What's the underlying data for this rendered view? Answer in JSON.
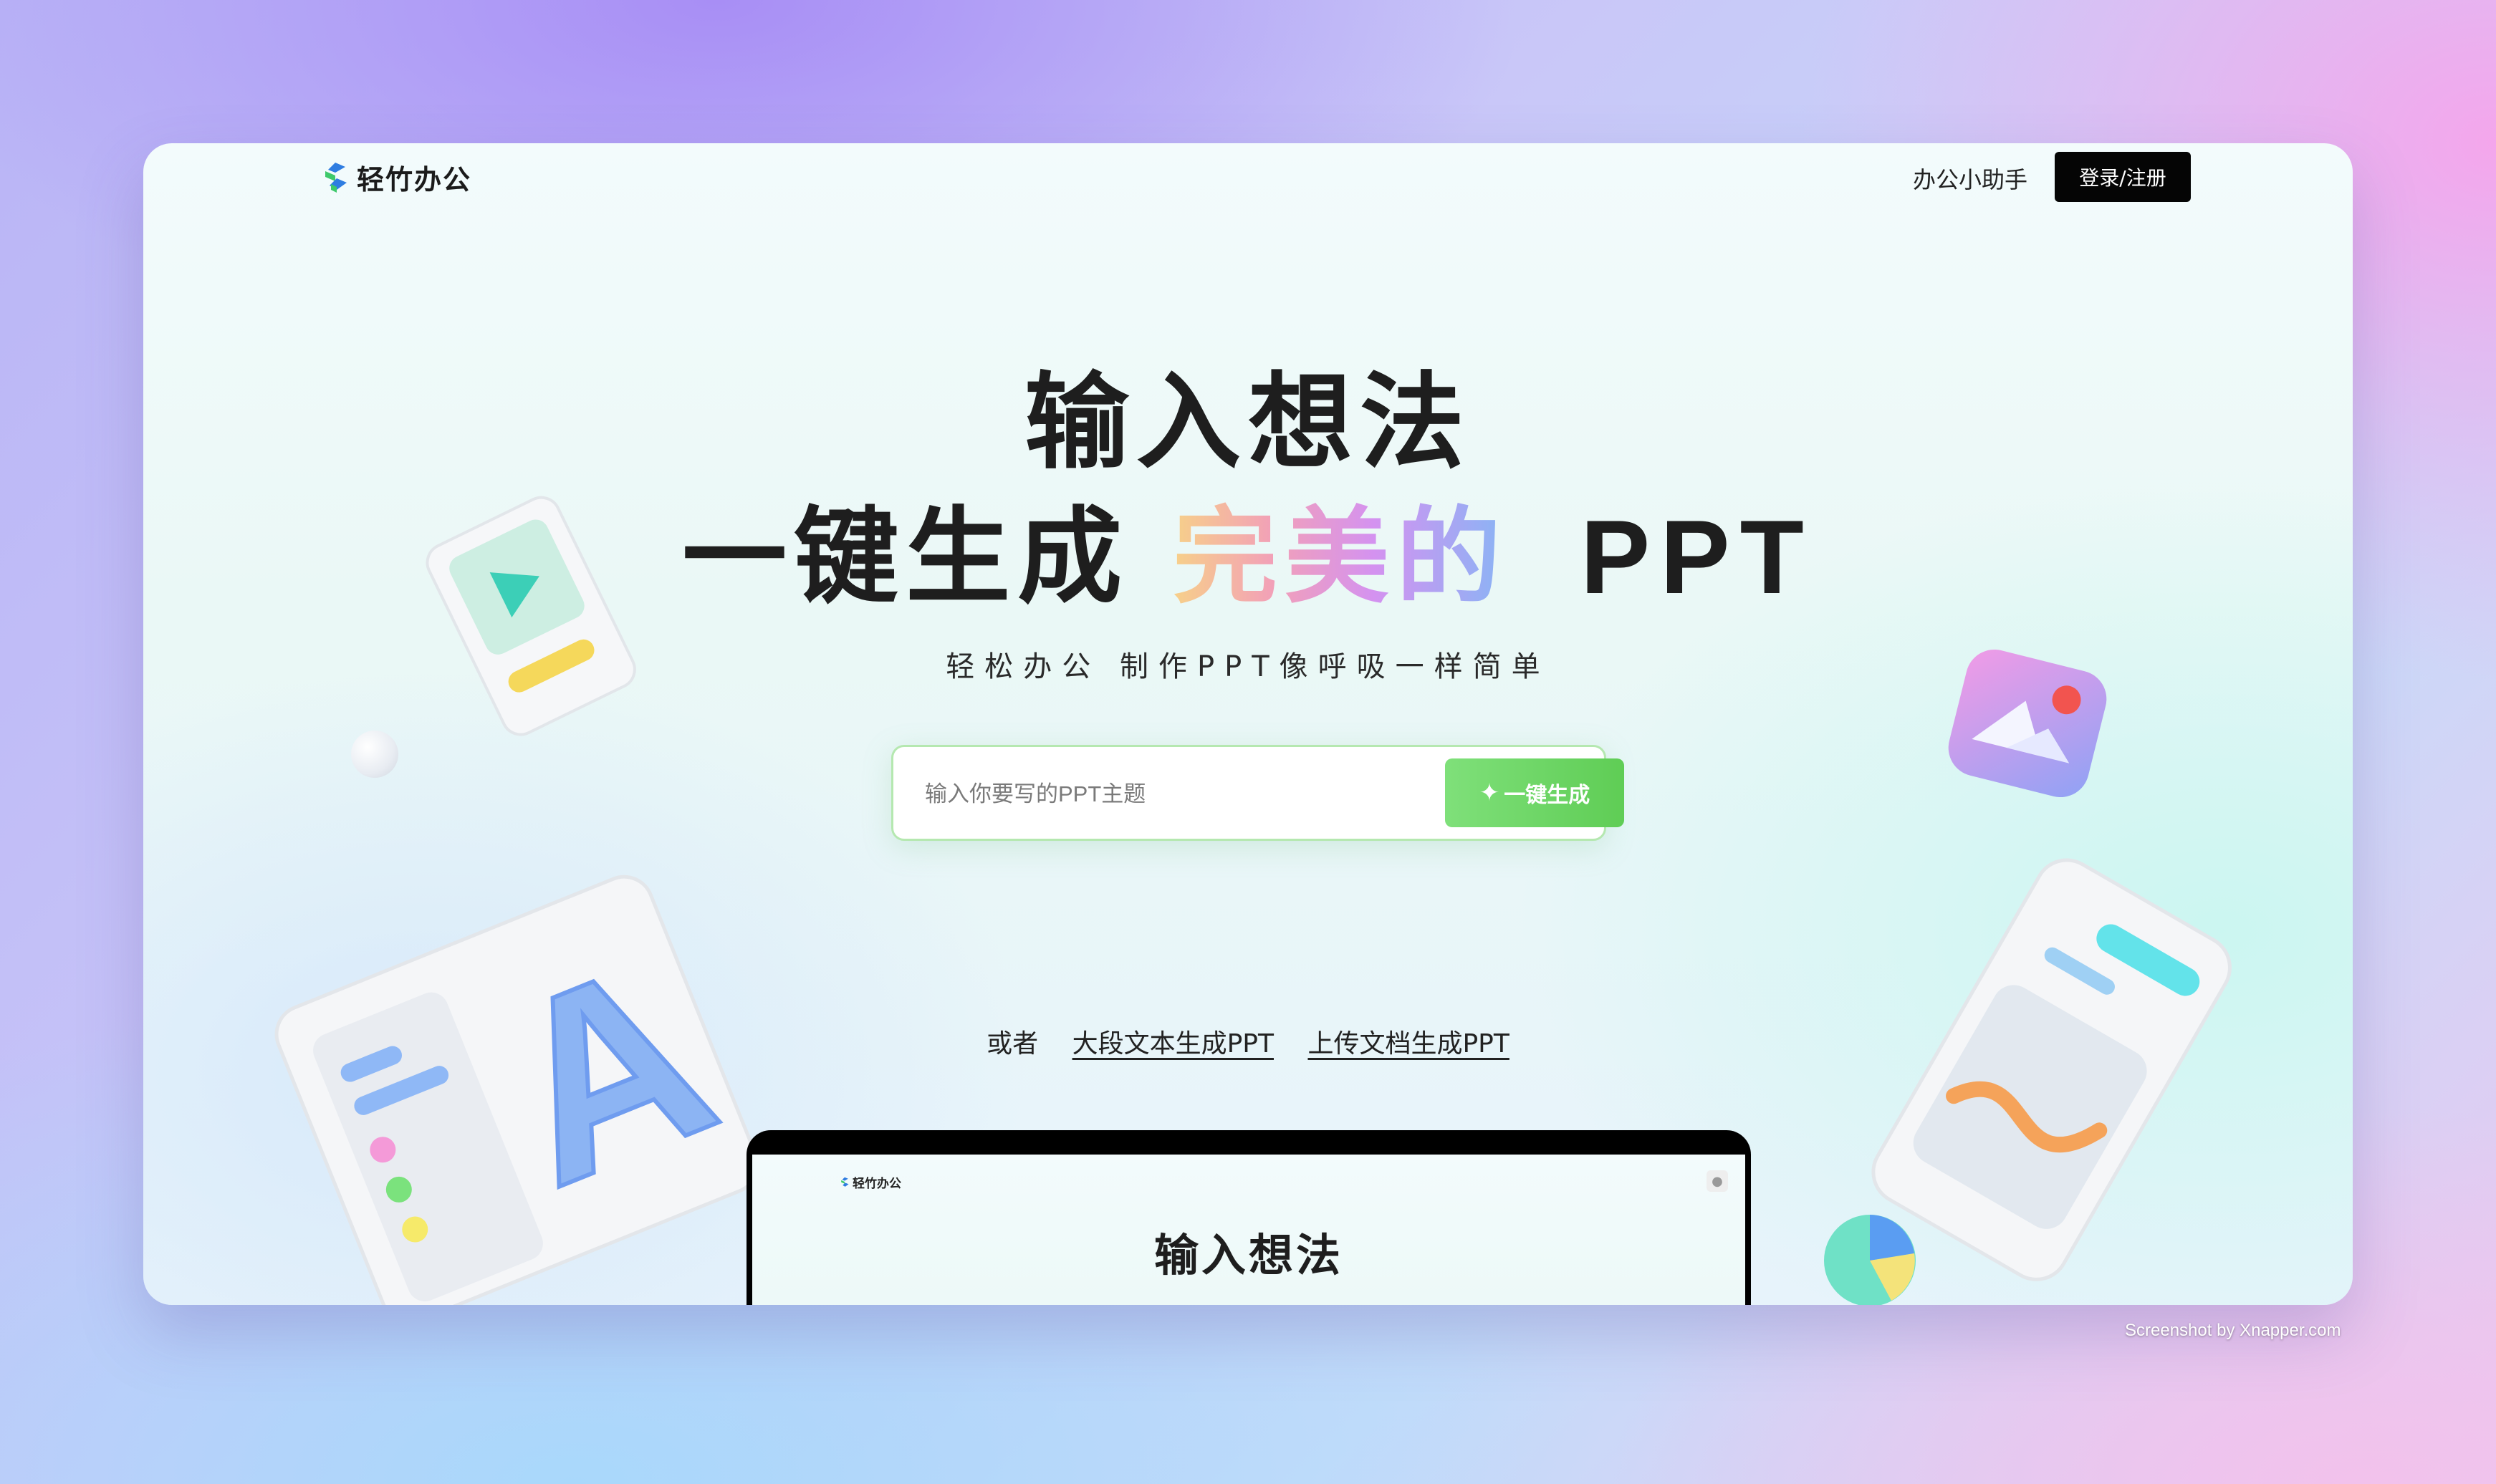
{
  "brand": {
    "name": "轻竹办公"
  },
  "nav": {
    "assistant": "办公小助手",
    "login": "登录/注册"
  },
  "hero": {
    "line1": "输入想法",
    "line2_prefix": "一键生成",
    "line2_highlight": "完美的",
    "line2_suffix": "PPT",
    "subtitle": "轻松办公 制作PPT像呼吸一样简单"
  },
  "search": {
    "placeholder": "输入你要写的PPT主题",
    "value": "",
    "button": "一键生成"
  },
  "alternatives": {
    "or": "或者",
    "link1": "大段文本生成PPT",
    "link2": "上传文档生成PPT"
  },
  "preview": {
    "brand": "轻竹办公",
    "title": "输入想法"
  },
  "watermark": "Screenshot by Xnapper.com",
  "colors": {
    "login_bg": "#050505",
    "generate_btn": "#6fd766",
    "gradient": [
      "#f7d089",
      "#f2a0b8",
      "#d492f0",
      "#88b5f5"
    ]
  }
}
